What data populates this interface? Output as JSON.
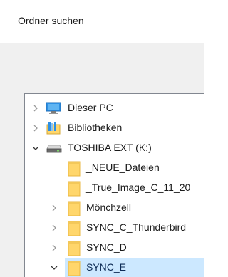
{
  "dialog": {
    "title": "Ordner suchen"
  },
  "tree": {
    "items": [
      {
        "label": "Dieser PC",
        "icon": "computer-icon",
        "expand": "collapsed"
      },
      {
        "label": "Bibliotheken",
        "icon": "library-icon",
        "expand": "collapsed"
      },
      {
        "label": "TOSHIBA EXT (K:)",
        "icon": "drive-icon",
        "expand": "expanded"
      },
      {
        "label": "_NEUE_Dateien",
        "icon": "folder-icon",
        "expand": "none"
      },
      {
        "label": "_True_Image_C_11_20",
        "icon": "folder-icon",
        "expand": "none"
      },
      {
        "label": "Mönchzell",
        "icon": "folder-icon",
        "expand": "collapsed"
      },
      {
        "label": "SYNC_C_Thunderbird",
        "icon": "folder-icon",
        "expand": "collapsed"
      },
      {
        "label": "SYNC_D",
        "icon": "folder-icon",
        "expand": "collapsed"
      },
      {
        "label": "SYNC_E",
        "icon": "folder-icon",
        "expand": "expanded",
        "selected": true
      }
    ]
  },
  "colors": {
    "selection": "#cce8ff",
    "folder": "#ffd66b",
    "folder_dark": "#e8b740",
    "pc_screen": "#2d8fe3",
    "background": "#f0f0f0"
  }
}
